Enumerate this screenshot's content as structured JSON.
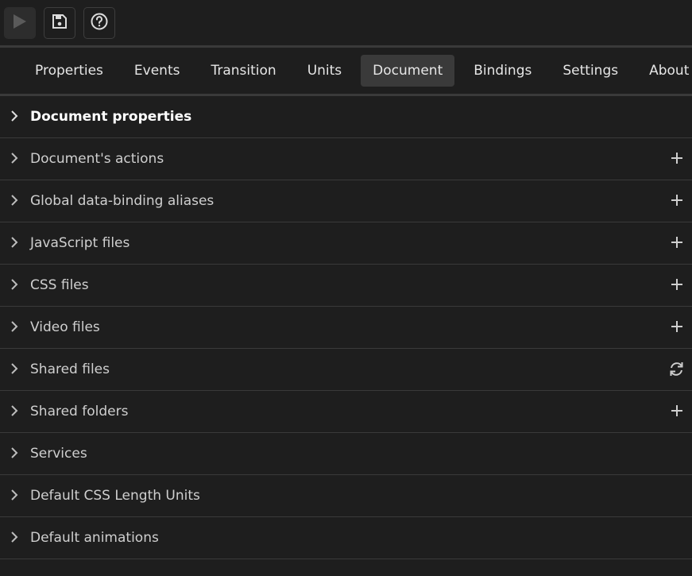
{
  "toolbar": {
    "buttons": [
      {
        "name": "play-button",
        "icon": "play-icon"
      },
      {
        "name": "save-button",
        "icon": "floppy-disk-icon"
      },
      {
        "name": "help-button",
        "icon": "question-circle-icon"
      }
    ]
  },
  "tabs": [
    {
      "label": "Properties",
      "active": false
    },
    {
      "label": "Events",
      "active": false
    },
    {
      "label": "Transition",
      "active": false
    },
    {
      "label": "Units",
      "active": false
    },
    {
      "label": "Document",
      "active": true
    },
    {
      "label": "Bindings",
      "active": false
    },
    {
      "label": "Settings",
      "active": false
    },
    {
      "label": "About",
      "active": false
    }
  ],
  "sections": [
    {
      "label": "Document properties",
      "action": "none"
    },
    {
      "label": "Document's actions",
      "action": "plus-icon"
    },
    {
      "label": "Global data-binding aliases",
      "action": "plus-icon"
    },
    {
      "label": "JavaScript files",
      "action": "plus-icon"
    },
    {
      "label": "CSS files",
      "action": "plus-icon"
    },
    {
      "label": "Video files",
      "action": "plus-icon"
    },
    {
      "label": "Shared files",
      "action": "refresh-icon"
    },
    {
      "label": "Shared folders",
      "action": "plus-icon"
    },
    {
      "label": "Services",
      "action": "none"
    },
    {
      "label": "Default CSS Length Units",
      "action": "none"
    },
    {
      "label": "Default animations",
      "action": "none"
    }
  ],
  "colors": {
    "background": "#1e1e1e",
    "active_tab": "#3a3a3a",
    "divider": "#3a3a3a",
    "icon": "#cfcfcf"
  }
}
